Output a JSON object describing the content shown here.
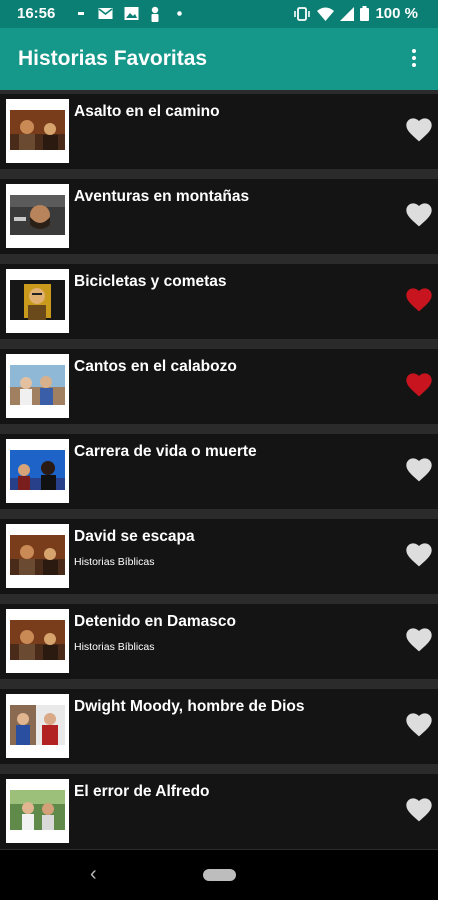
{
  "status": {
    "time": "16:56",
    "battery": "100 %",
    "left_icons": [
      "minus-icon",
      "mail-icon",
      "photo-icon",
      "person-icon",
      "dot-icon"
    ],
    "right_icons": [
      "vibrate-icon",
      "wifi-icon",
      "signal-icon",
      "battery-icon"
    ]
  },
  "appbar": {
    "title": "Historias Favoritas",
    "menu_icon": "more-vert-icon"
  },
  "items": [
    {
      "title": "Asalto en el camino",
      "subtitle": "",
      "favorite": false
    },
    {
      "title": "Aventuras en montañas",
      "subtitle": "",
      "favorite": false
    },
    {
      "title": "Bicicletas y cometas",
      "subtitle": "",
      "favorite": true
    },
    {
      "title": "Cantos en el calabozo",
      "subtitle": "",
      "favorite": true
    },
    {
      "title": "Carrera de vida o muerte",
      "subtitle": "",
      "favorite": false
    },
    {
      "title": "David se escapa",
      "subtitle": "Historias Bíblicas",
      "favorite": false
    },
    {
      "title": "Detenido en Damasco",
      "subtitle": "Historias Bíblicas",
      "favorite": false
    },
    {
      "title": "Dwight Moody, hombre de Dios",
      "subtitle": "",
      "favorite": false
    },
    {
      "title": "El error de Alfredo",
      "subtitle": "",
      "favorite": false
    }
  ],
  "colors": {
    "status_bar": "#0b7f73",
    "app_bar": "#15978a",
    "list_bg": "#141414",
    "separator": "#2b2b2b",
    "heart_favorite": "#c8141e",
    "heart_default": "#dddddd"
  },
  "navbar": {
    "back_icon": "back-chevron-icon",
    "home_icon": "home-pill-icon"
  }
}
